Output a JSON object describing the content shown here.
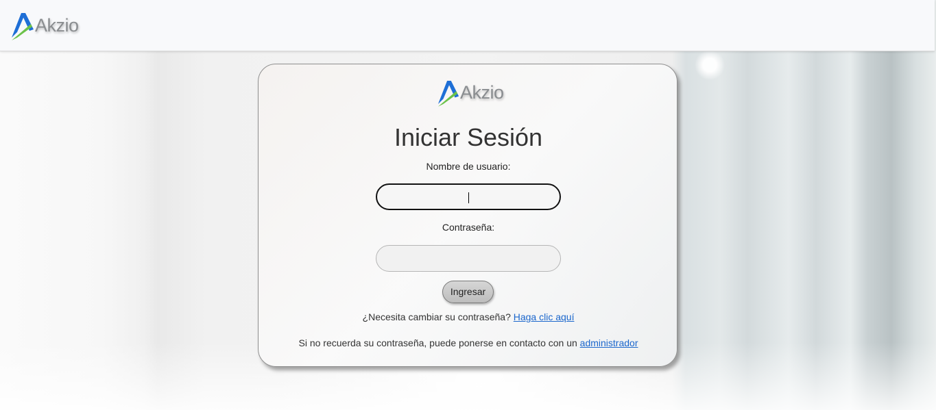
{
  "header": {
    "logo_text": "Akzio"
  },
  "login": {
    "logo_text": "Akzio",
    "title": "Iniciar Sesión",
    "username_label": "Nombre de usuario:",
    "username_value": "",
    "password_label": "Contraseña:",
    "password_value": "",
    "submit_label": "Ingresar",
    "change_password_prompt": "¿Necesita cambiar su contraseña?",
    "change_password_link": "Haga clic aquí",
    "forgot_prompt": "Si no recuerda su contraseña, puede ponerse en contacto con un",
    "forgot_link": "administrador"
  },
  "colors": {
    "logo_blue": "#1f6fd6",
    "logo_green": "#6cc24a",
    "link": "#1a66cc"
  },
  "icons": {
    "brand": "akzio-logo-mark-icon"
  }
}
